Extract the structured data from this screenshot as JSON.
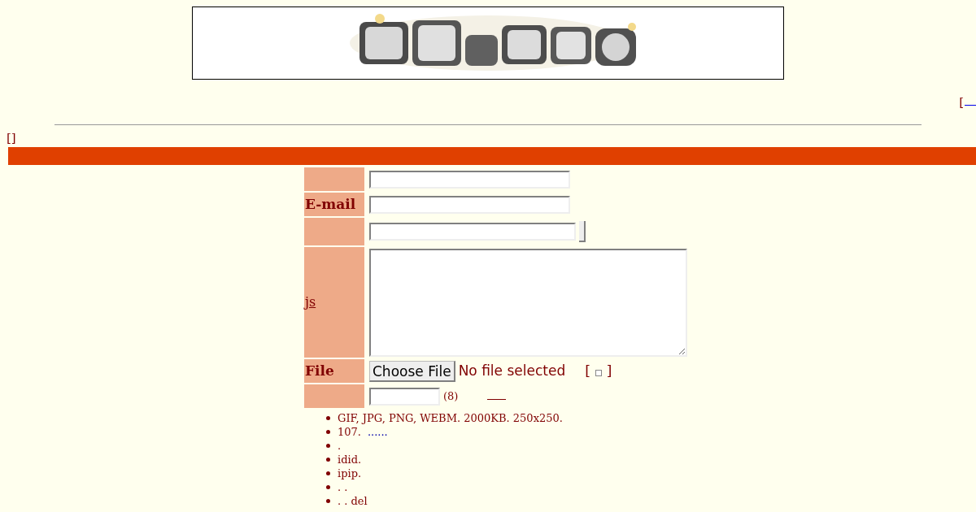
{
  "top_link": {
    "bracket": "["
  },
  "left_bracket": "[]",
  "form": {
    "rows": [
      {
        "kind": "text"
      },
      {
        "kind": "text",
        "label": "E-mail"
      },
      {
        "kind": "text_button"
      },
      {
        "kind": "textarea",
        "label": "js",
        "label_link": true
      },
      {
        "kind": "file",
        "label": "File",
        "button": "Choose File",
        "status": "No file selected",
        "bracket_open": "[",
        "bracket_close": "]",
        "checked": false
      },
      {
        "kind": "password",
        "note": "(8)"
      }
    ]
  },
  "notes": [
    {
      "text": "GIF, JPG, PNG, WEBM. 2000KB. 250x250."
    },
    {
      "text": "107.",
      "link": "......"
    },
    {
      "text": "."
    },
    {
      "text": "idid."
    },
    {
      "text": "ipip."
    },
    {
      "text": ". ."
    },
    {
      "text": ". . del"
    }
  ]
}
